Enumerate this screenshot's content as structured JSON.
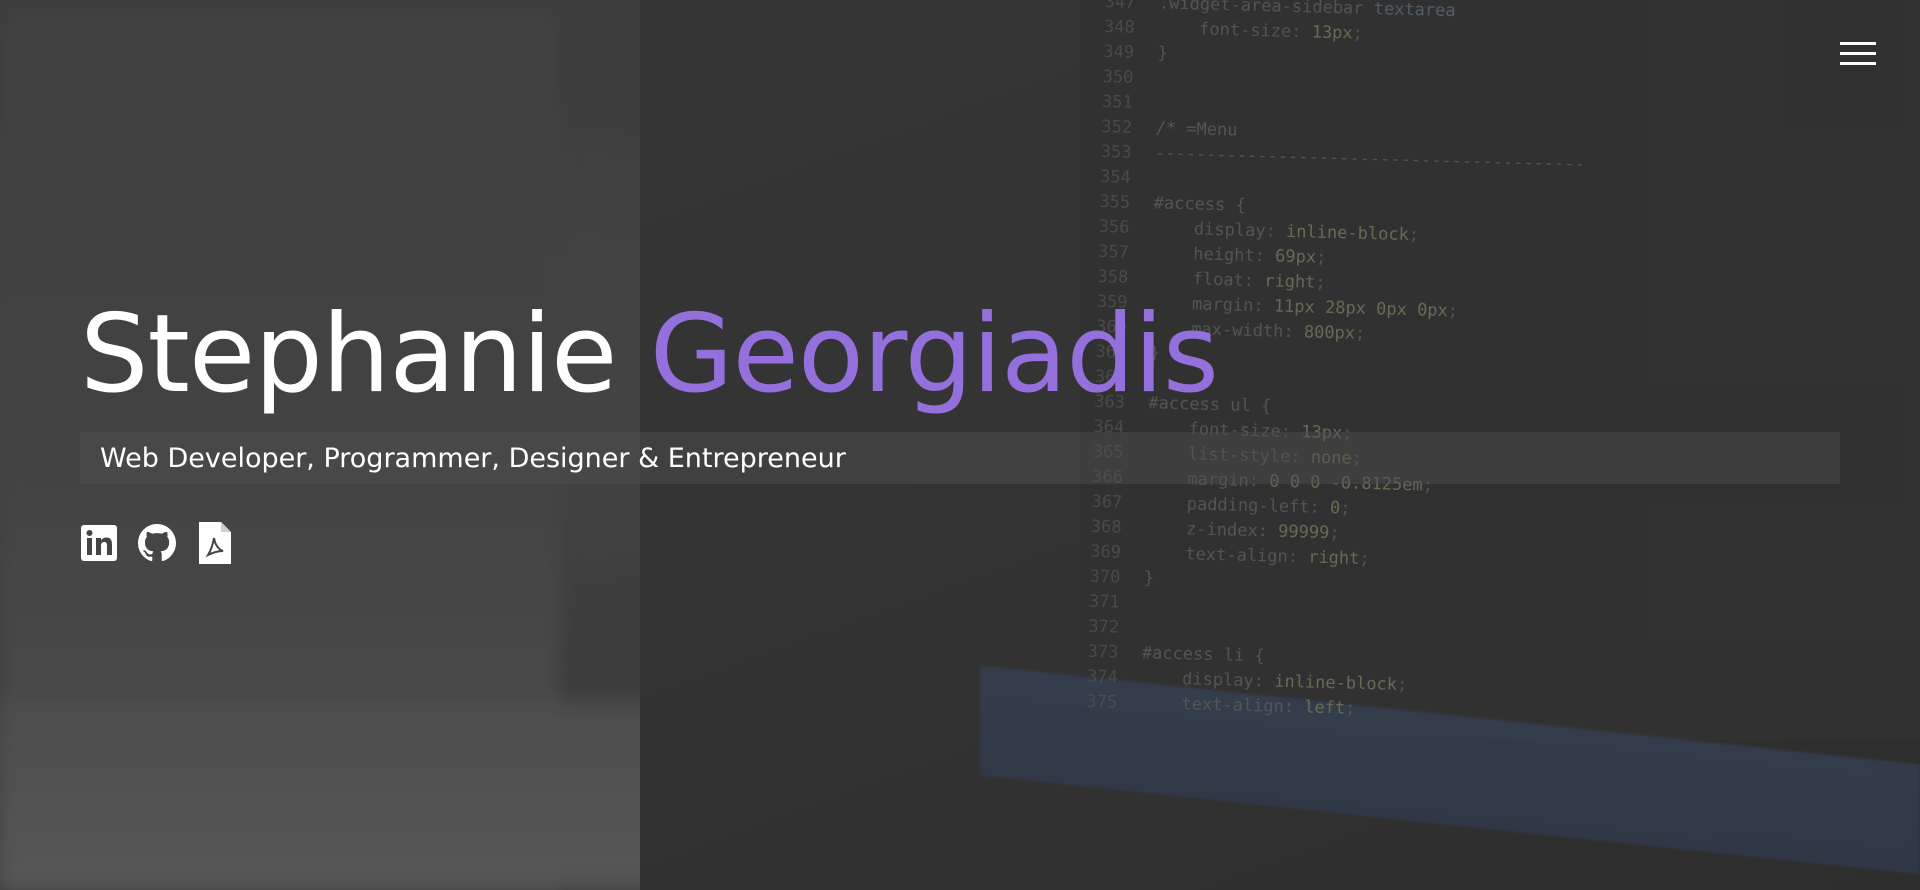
{
  "header": {
    "menu_icon": "hamburger-menu-icon"
  },
  "hero": {
    "first_name": "Stephanie",
    "last_name": "Georgiadis",
    "tagline": "Web Developer, Programmer, Designer & Entrepreneur",
    "accent_color": "#9370db",
    "text_color": "#ffffff"
  },
  "socials": [
    {
      "icon": "linkedin-icon"
    },
    {
      "icon": "github-icon"
    },
    {
      "icon": "pdf-icon"
    }
  ]
}
